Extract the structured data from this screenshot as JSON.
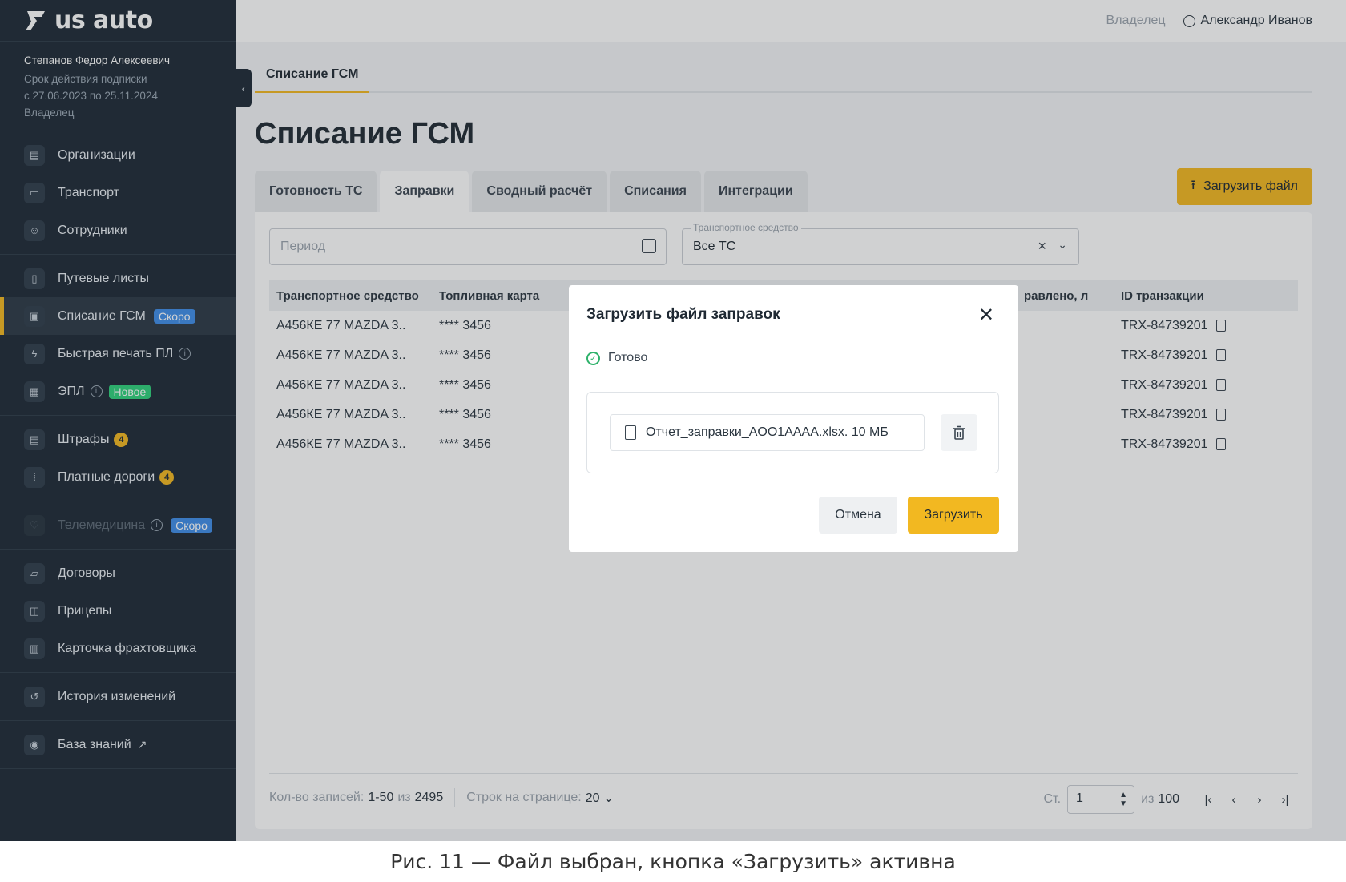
{
  "brand": {
    "logo_text": "us auto"
  },
  "user": {
    "name": "Степанов Федор Алексеевич",
    "subscription_label": "Срок действия подписки",
    "subscription_period": "с 27.06.2023 по 25.11.2024",
    "role": "Владелец"
  },
  "sidebar": {
    "groups": [
      [
        {
          "label": "Организации",
          "icon": "building-icon"
        },
        {
          "label": "Транспорт",
          "icon": "car-icon"
        },
        {
          "label": "Сотрудники",
          "icon": "people-icon"
        }
      ],
      [
        {
          "label": "Путевые листы",
          "icon": "document-icon"
        },
        {
          "label": "Списание ГСМ",
          "icon": "fuel-icon",
          "badge": "Скоро",
          "active": true
        },
        {
          "label": "Быстрая печать ПЛ",
          "icon": "bolt-icon",
          "info": "i"
        },
        {
          "label": "ЭПЛ",
          "icon": "epl-icon",
          "info": "i",
          "badge": "Новое"
        }
      ],
      [
        {
          "label": "Штрафы",
          "icon": "fine-icon",
          "count": "4"
        },
        {
          "label": "Платные дороги",
          "icon": "road-icon",
          "count": "4"
        }
      ],
      [
        {
          "label": "Телемедицина",
          "icon": "heart-icon",
          "info": "i",
          "badge": "Скоро",
          "disabled": true
        }
      ],
      [
        {
          "label": "Договоры",
          "icon": "folder-icon"
        },
        {
          "label": "Прицепы",
          "icon": "trailer-icon"
        },
        {
          "label": "Карточка фрахтовщика",
          "icon": "card-icon"
        }
      ],
      [
        {
          "label": "История изменений",
          "icon": "history-icon"
        }
      ],
      [
        {
          "label": "База знаний",
          "icon": "bulb-icon",
          "external": "↗"
        }
      ]
    ]
  },
  "header": {
    "role": "Владелец",
    "account_name": "Александр Иванов"
  },
  "page": {
    "breadcrumb_tab": "Списание ГСМ",
    "title": "Списание ГСМ",
    "tabs": [
      "Готовность ТС",
      "Заправки",
      "Сводный расчёт",
      "Списания",
      "Интеграции"
    ],
    "active_tab": "Заправки",
    "upload_button": "Загрузить файл"
  },
  "filters": {
    "period_placeholder": "Период",
    "vehicle_legend": "Транспортное средство",
    "vehicle_value": "Все ТС"
  },
  "table": {
    "columns": [
      "Транспортное средство",
      "Топливная карта",
      "равлено, л",
      "ID транзакции"
    ],
    "rows": [
      {
        "vehicle": "А456КЕ 77 MAZDA 3..",
        "card": "**** 3456",
        "transaction": "TRX-84739201"
      },
      {
        "vehicle": "А456КЕ 77 MAZDA 3..",
        "card": "**** 3456",
        "transaction": "TRX-84739201"
      },
      {
        "vehicle": "А456КЕ 77 MAZDA 3..",
        "card": "**** 3456",
        "transaction": "TRX-84739201"
      },
      {
        "vehicle": "А456КЕ 77 MAZDA 3..",
        "card": "**** 3456",
        "transaction": "TRX-84739201"
      },
      {
        "vehicle": "А456КЕ 77 MAZDA 3..",
        "card": "**** 3456",
        "transaction": "TRX-84739201"
      }
    ]
  },
  "footer": {
    "records_label": "Кол-во записей:",
    "records_range": "1-50",
    "records_of": "из",
    "records_total": "2495",
    "rows_per_page_label": "Строк на странице:",
    "rows_per_page": "20",
    "page_label": "Ст.",
    "page_value": "1",
    "page_of": "из",
    "page_total": "100"
  },
  "modal": {
    "title": "Загрузить файл заправок",
    "status": "Готово",
    "file_label": "Отчет_заправки_AOO1AAAA.xlsx. 10 МБ",
    "cancel": "Отмена",
    "submit": "Загрузить"
  },
  "caption": "Рис. 11 — Файл выбран, кнопка «Загрузить» активна",
  "colors": {
    "accent": "#f2b821",
    "sidebar": "#1e2a36",
    "success": "#2fb26b",
    "badge_soon": "#3f8ee8",
    "badge_new": "#2fd17b"
  }
}
